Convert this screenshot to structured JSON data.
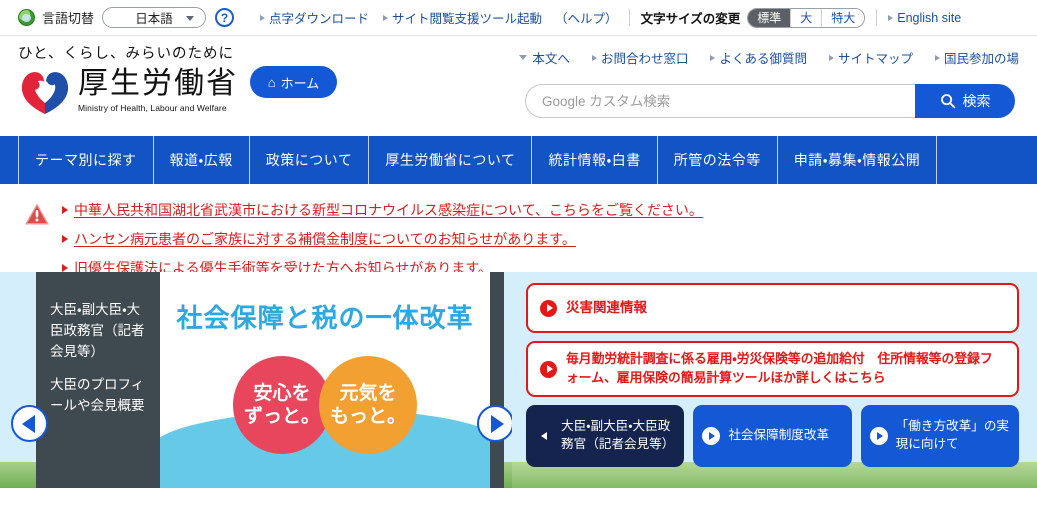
{
  "topbar": {
    "globe_icon": "globe-icon",
    "lang_label": "言語切替",
    "lang_value": "日本語",
    "help_icon": "?",
    "links": [
      {
        "label": "点字ダウンロード"
      },
      {
        "label": "サイト閲覧支援ツール起動"
      }
    ],
    "help_paren": "（ヘルプ）",
    "fontsize_label": "文字サイズの変更",
    "fontsize_options": [
      {
        "label": "標準",
        "selected": true
      },
      {
        "label": "大",
        "selected": false
      },
      {
        "label": "特大",
        "selected": false
      }
    ],
    "english_link": "English site"
  },
  "header": {
    "tagline": "ひと、くらし、みらいのために",
    "ministry_ja": "厚生労働省",
    "ministry_en": "Ministry of Health, Labour and Welfare",
    "home_button": "ホーム",
    "home_icon": "home-icon",
    "links": [
      {
        "label": "本文へ"
      },
      {
        "label": "お問合わせ窓口"
      },
      {
        "label": "よくある御質問"
      },
      {
        "label": "サイトマップ"
      },
      {
        "label": "国民参加の場"
      }
    ],
    "search_placeholder": "Google カスタム検索",
    "search_value": "",
    "search_button": "検索",
    "search_icon": "search-icon"
  },
  "global_nav": [
    {
      "label": "テーマ別に探す"
    },
    {
      "label": "報道・広報"
    },
    {
      "label": "政策について"
    },
    {
      "label": "厚生労働省について"
    },
    {
      "label": "統計情報・白書"
    },
    {
      "label": "所管の法令等"
    },
    {
      "label": "申請・募集・情報公開"
    }
  ],
  "alerts": {
    "icon": "warning-icon",
    "items": [
      {
        "label": "中華人民共和国湖北省武漢市における新型コロナウイルス感染症について、こちらをご覧ください。"
      },
      {
        "label": "ハンセン病元患者のご家族に対する補償金制度についてのお知らせがあります。"
      },
      {
        "label": "旧優生保護法による優生手術等を受けた方へお知らせがあります。"
      }
    ]
  },
  "carousel": {
    "prev_icon": "chevron-left-icon",
    "next_icon": "chevron-right-icon",
    "dark_panel": {
      "line1": "大臣・副大臣・大臣政務官（記者会見等）",
      "line2": "大臣のプロフィールや会見概要"
    },
    "slide": {
      "title": "社会保障と税の一体改革",
      "circle_red_l1": "安心を",
      "circle_red_l1_small": "を",
      "circle_red_l2": "ずっと。",
      "circle_orange_l1": "元気を",
      "circle_orange_l2": "もっと。"
    }
  },
  "right_column": {
    "red_boxes": [
      {
        "label": "災害関連情報",
        "icon": "arrow-circle-icon"
      },
      {
        "label": "毎月勤労統計調査に係る雇用・労災保険等の追加給付　住所情報等の登録フォーム、雇用保険の簡易計算ツールほか詳しくはこちら",
        "icon": "arrow-circle-icon"
      }
    ],
    "blue_boxes": [
      {
        "label": "大臣・副大臣・大臣政務官（記者会見等）",
        "style": "navy",
        "icon": "chevron-left-icon"
      },
      {
        "label": "社会保障制度改革",
        "style": "blue",
        "icon": "arrow-circle-icon"
      },
      {
        "label": "「働き方改革」の実現に向けて",
        "style": "blue",
        "icon": "arrow-circle-icon"
      }
    ]
  },
  "colors": {
    "nav_blue": "#1254c4",
    "accent_blue": "#1558d6",
    "alert_red": "#d81e1e",
    "box_red": "#e51717",
    "navy": "#14244f",
    "content_bg": "#d4eefb",
    "link_blue": "#1a4fa3"
  }
}
